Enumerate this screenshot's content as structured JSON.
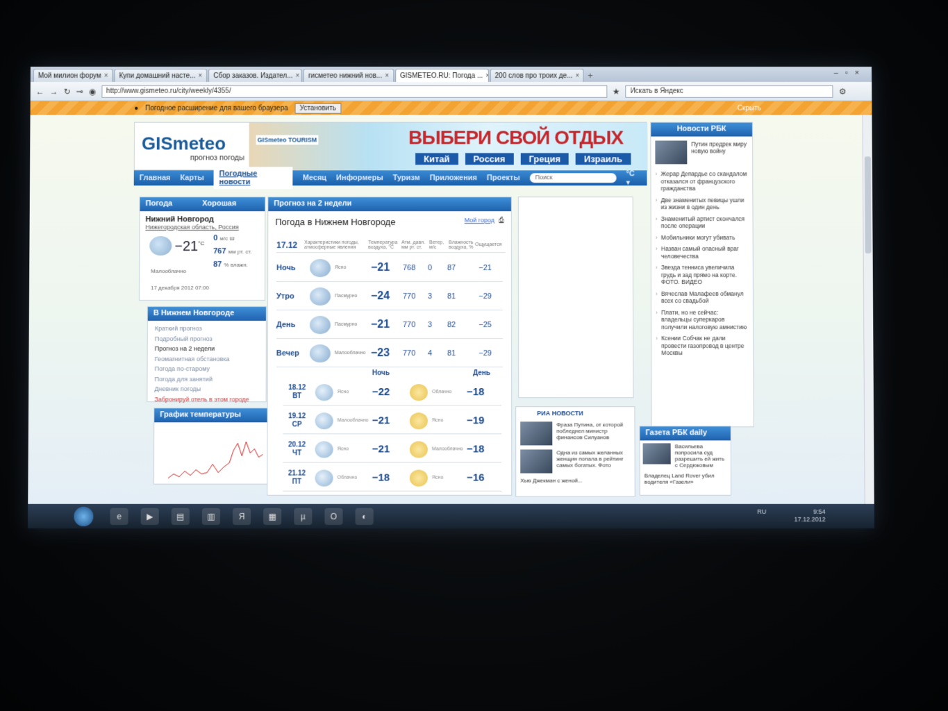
{
  "browser": {
    "tabs": [
      {
        "label": "Мой милион форум"
      },
      {
        "label": "Купи домашний насте..."
      },
      {
        "label": "Сбор заказов. Издател..."
      },
      {
        "label": "гисметео нижний нов..."
      },
      {
        "label": "GISMETEO.RU: Погода ...",
        "active": true
      },
      {
        "label": "200 слов про троих де..."
      }
    ],
    "url": "http://www.gismeteo.ru/city/weekly/4355/",
    "yandex_search": "Искать в Яндекс",
    "infobar_text": "Погодное расширение для вашего браузера",
    "infobar_install": "Установить",
    "infobar_hide": "Скрыть"
  },
  "header": {
    "logo": "GISmeteo",
    "logo_sub": "прогноз погоды",
    "tourism_tag": "GISmeteo TOURISM",
    "banner_title": "ВЫБЕРИ СВОЙ ОТДЫХ",
    "countries": [
      "Китай",
      "Россия",
      "Греция",
      "Израиль"
    ]
  },
  "menu": {
    "items": [
      "Главная",
      "Карты",
      "Погодные новости",
      "Месяц",
      "Информеры",
      "Туризм",
      "Приложения",
      "Проекты"
    ],
    "search_placeholder": "Поиск",
    "unit": "°C ▾"
  },
  "weather_now": {
    "header": "Погода",
    "rating": "Хорошая",
    "city": "Нижний Новгород",
    "region": "Нижегородская область, Россия",
    "temp": "−21",
    "temp_unit": "°C",
    "wind": "0",
    "wind_unit": "м/с Ш",
    "pressure": "767",
    "pressure_unit": "мм рт. ст.",
    "humidity": "87",
    "humidity_unit": "% влажн.",
    "condition": "Малооблачно",
    "date": "17 декабря 2012 07:00"
  },
  "city_menu": {
    "header": "В Нижнем Новгороде",
    "items": [
      "Краткий прогноз",
      "Подробный прогноз",
      "Прогноз на 2 недели",
      "Геомагнитная обстановка",
      "Погода по-старому",
      "Погода для занятий",
      "Дневник погоды",
      "Забронируй отель в этом городе"
    ]
  },
  "graph": {
    "header": "График температуры"
  },
  "forecast": {
    "header": "Прогноз на 2 недели",
    "title": "Погода в Нижнем Новгороде",
    "my_city": "Мой город",
    "date": "17.12",
    "columns": [
      "Характеристики погоды, атмосферные явления",
      "Температура воздуха, °C",
      "Атм. давл. мм рт. ст.",
      "Ветер, м/с",
      "Влажность воздуха, %",
      "Ощущается"
    ],
    "rows": [
      {
        "period": "Ночь",
        "cond": "Ясно",
        "temp": "−21",
        "pressure": "768",
        "wind": "0",
        "humidity": "87",
        "feels": "−21"
      },
      {
        "period": "Утро",
        "cond": "Пасмурно",
        "temp": "−24",
        "pressure": "770",
        "wind": "3",
        "humidity": "81",
        "feels": "−29"
      },
      {
        "period": "День",
        "cond": "Пасмурно",
        "temp": "−21",
        "pressure": "770",
        "wind": "3",
        "humidity": "82",
        "feels": "−25"
      },
      {
        "period": "Вечер",
        "cond": "Малооблачно",
        "temp": "−23",
        "pressure": "770",
        "wind": "4",
        "humidity": "81",
        "feels": "−29"
      }
    ],
    "night_label": "Ночь",
    "day_label": "День",
    "days": [
      {
        "date": "18.12",
        "dow": "ВТ",
        "night_cond": "Ясно",
        "night_temp": "−22",
        "day_cond": "Облачно",
        "day_temp": "−18"
      },
      {
        "date": "19.12",
        "dow": "СР",
        "night_cond": "Малооблачно",
        "night_temp": "−21",
        "day_cond": "Ясно",
        "day_temp": "−19"
      },
      {
        "date": "20.12",
        "dow": "ЧТ",
        "night_cond": "Ясно",
        "night_temp": "−21",
        "day_cond": "Малооблачно",
        "day_temp": "−18"
      },
      {
        "date": "21.12",
        "dow": "ПТ",
        "night_cond": "Облачно",
        "night_temp": "−18",
        "day_cond": "Ясно",
        "day_temp": "−16"
      }
    ]
  },
  "ria": {
    "header": "РИА НОВОСТИ",
    "items": [
      "Фраза Путина, от которой побледнел министр финансов Силуанов",
      "Одна из самых желанных женщин попала в рейтинг самых богатых. Фото",
      "Хью Джекман с женой..."
    ]
  },
  "rbk": {
    "header": "Новости РБК",
    "lead": "Путин предрек миру новую войну",
    "items": [
      "Жерар Депардье со скандалом отказался от французского гражданства",
      "Две знаменитых певицы ушли из жизни в один день",
      "Знаменитый артист скончался после операции",
      "Мобильники могут убивать",
      "Назван самый опасный враг человечества",
      "Звезда тенниса увеличила грудь и зад прямо на корте. ФОТО. ВИДЕО",
      "Вячеслав Малафеев обманул всех со свадьбой",
      "Плати, но не сейчас: владельцы суперкаров получили налоговую амнистию",
      "Ксении Собчак не дали провести газопровод в центре Москвы"
    ]
  },
  "gazeta": {
    "header": "Газета РБК daily",
    "items": [
      "Васильева попросила суд разрешить ей жить с Сердюковым",
      "Владелец Land Rover убил водителя «Газели»"
    ]
  },
  "taskbar": {
    "lang": "RU",
    "time": "9:54",
    "date": "17.12.2012"
  }
}
